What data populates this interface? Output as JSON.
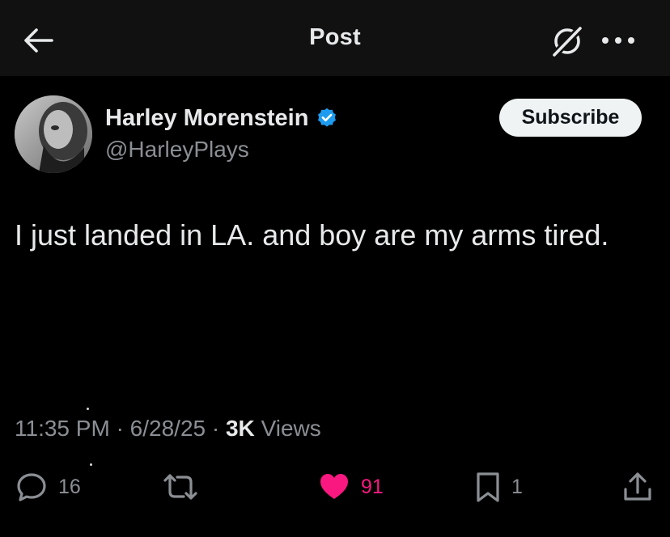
{
  "header": {
    "title": "Post",
    "back_icon": "arrow-left-icon",
    "grok_icon": "grok-icon",
    "more_icon": "more-horizontal-icon"
  },
  "author": {
    "display_name": "Harley Morenstein",
    "handle": "@HarleyPlays",
    "verified": true,
    "verified_color": "#1d9bf0",
    "avatar_icon": "avatar-icon",
    "subscribe_label": "Subscribe"
  },
  "post": {
    "text": "I just landed in LA. and boy are my arms tired."
  },
  "meta": {
    "time": "11:35 PM",
    "sep1": "·",
    "date": "6/28/25",
    "sep2": "·",
    "views_count": "3K",
    "views_label": "Views"
  },
  "actions": {
    "reply_count": "16",
    "repost_count": "",
    "like_count": "91",
    "bookmark_count": "1",
    "like_color": "#f91880",
    "icons": [
      "reply-icon",
      "repost-icon",
      "heart-icon",
      "bookmark-icon",
      "share-icon"
    ]
  },
  "colors": {
    "background": "#000000",
    "header_background": "#111111",
    "primary_text": "#e7e9ea",
    "secondary_text": "#8b8f94",
    "button_background": "#eff3f4",
    "button_text": "#0f1419"
  }
}
